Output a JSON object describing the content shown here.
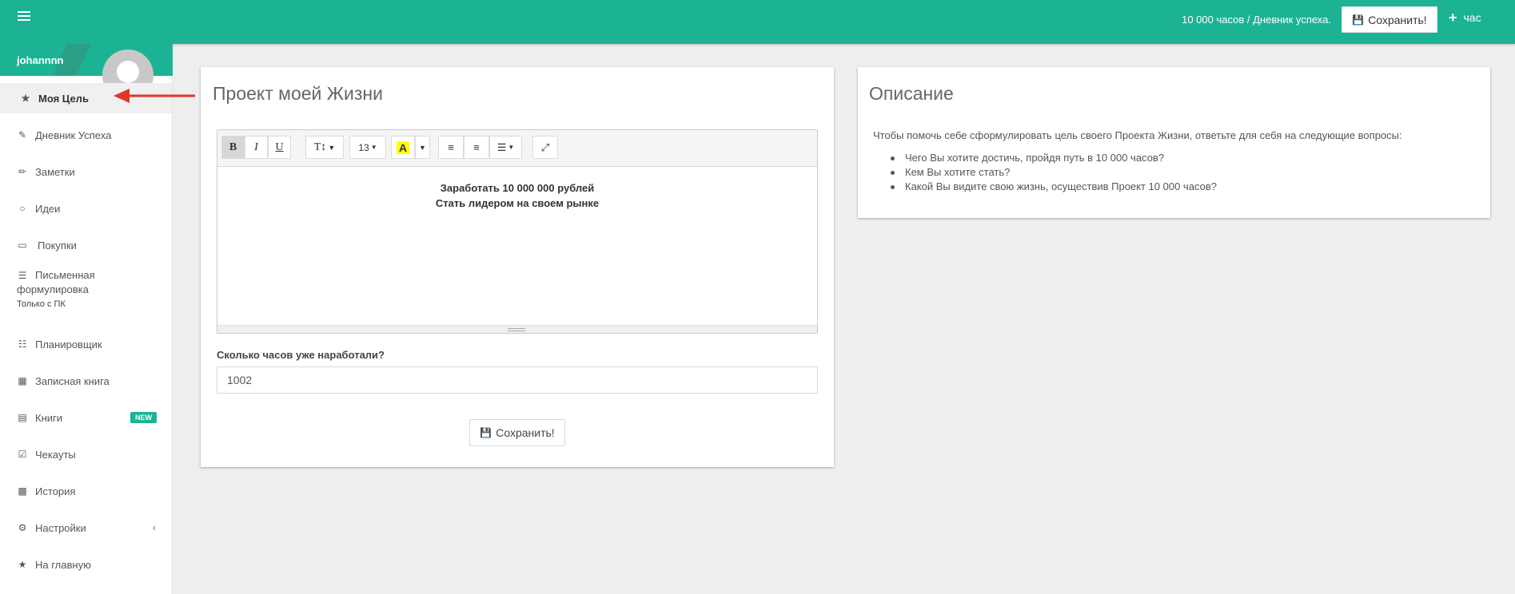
{
  "header": {
    "title": "10 000 часов / Дневник успеха.",
    "save_label": "Сохранить!",
    "hour_label": "час"
  },
  "user": {
    "name": "johannnn"
  },
  "sidebar": {
    "items": [
      {
        "label": "Моя Цель",
        "icon": "star-icon"
      },
      {
        "label": "Дневник Успеха",
        "icon": "edit-icon"
      },
      {
        "label": "Заметки",
        "icon": "pencil-icon"
      },
      {
        "label": "Идеи",
        "icon": "lightbulb-icon"
      },
      {
        "label": "Покупки",
        "icon": "laptop-icon"
      },
      {
        "label": "Письменная",
        "label2": "формулировка",
        "note": "Только с ПК",
        "icon": "list-icon"
      },
      {
        "label": "Планировщик",
        "icon": "sitemap-icon"
      },
      {
        "label": "Записная книга",
        "icon": "grid-icon"
      },
      {
        "label": "Книги",
        "icon": "book-icon",
        "badge": "NEW"
      },
      {
        "label": "Чекауты",
        "icon": "check-square-icon"
      },
      {
        "label": "История",
        "icon": "bar-chart-icon"
      },
      {
        "label": "Настройки",
        "icon": "cogs-icon"
      },
      {
        "label": "На главную",
        "icon": "star-icon"
      }
    ]
  },
  "goal": {
    "title": "Проект моей Жизни",
    "editor": {
      "font_size": "13",
      "lines": [
        "Заработать 10 000 000 рублей",
        "Стать лидером на своем рынке"
      ]
    },
    "hours_label": "Сколько часов уже наработали?",
    "hours_value": "1002",
    "save_label": "Сохранить!"
  },
  "description": {
    "title": "Описание",
    "intro": "Чтобы помочь себе сформулировать цель своего Проекта Жизни, ответьте для себя на следующие вопросы:",
    "questions": [
      "Чего Вы хотите достичь, пройдя путь в 10 000 часов?",
      "Кем Вы хотите стать?",
      "Какой Вы видите свою жизнь, осуществив Проект 10 000 часов?"
    ]
  },
  "colors": {
    "brand": "#1bb394",
    "arrow": "#e0362c"
  }
}
